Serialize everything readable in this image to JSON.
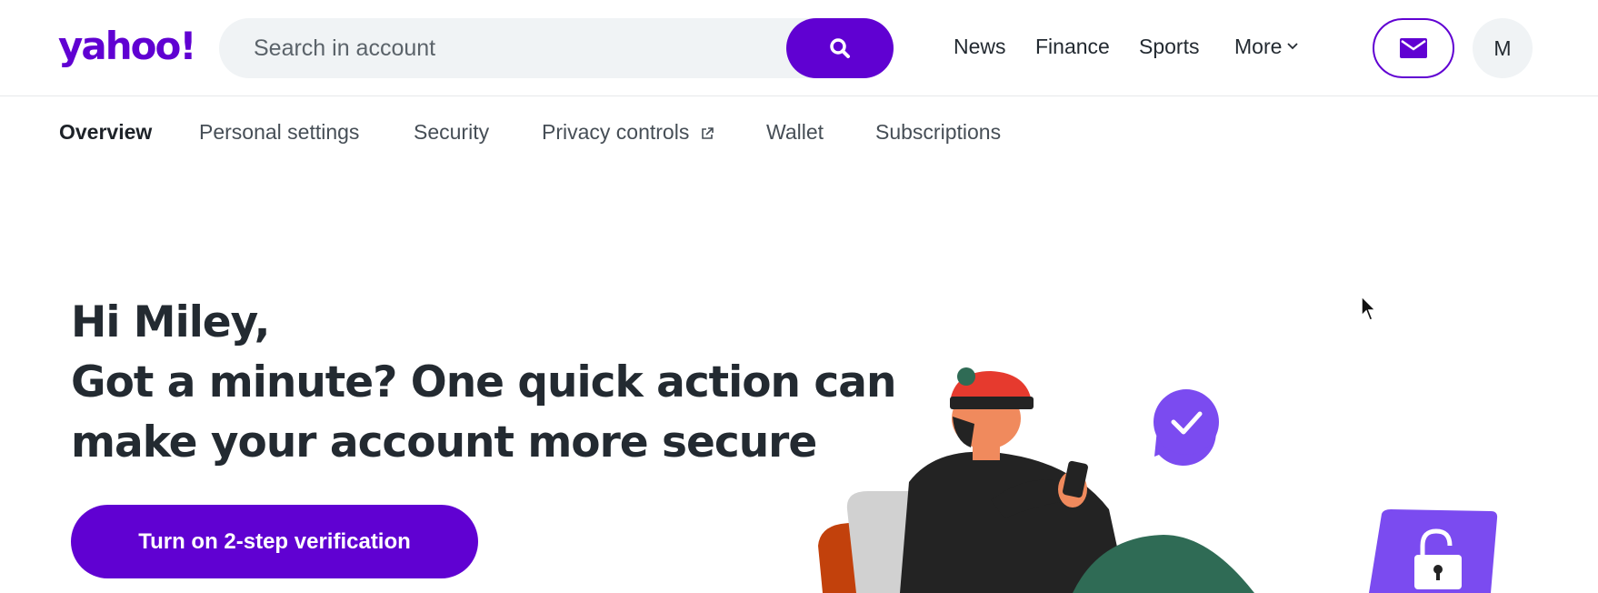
{
  "header": {
    "logo": "yahoo!",
    "search": {
      "placeholder": "Search in account",
      "value": ""
    },
    "nav": [
      "News",
      "Finance",
      "Sports",
      "More"
    ],
    "avatar_initial": "M"
  },
  "subnav": {
    "items": [
      "Overview",
      "Personal settings",
      "Security",
      "Privacy controls",
      "Wallet",
      "Subscriptions"
    ],
    "active": "Overview"
  },
  "hero": {
    "greeting": "Hi Miley,",
    "line2": "Got a minute? One quick action can",
    "line3": "make your account more secure",
    "cta_label": "Turn on 2-step verification"
  },
  "colors": {
    "brand": "#6001d2",
    "text": "#232a31",
    "search_bg": "#f0f3f5"
  }
}
